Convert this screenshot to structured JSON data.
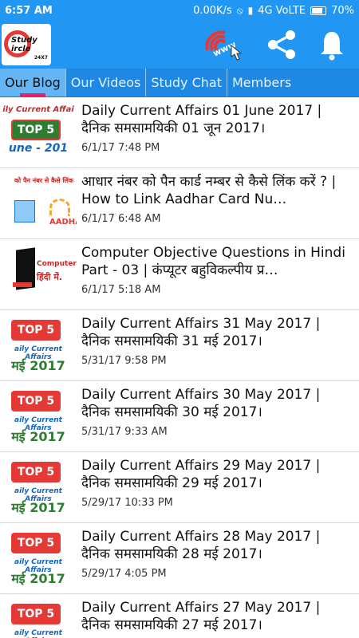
{
  "status": {
    "time": "6:57 AM",
    "speed": "0.00K/s",
    "network": "4G VoLTE",
    "battery": "70%"
  },
  "appbar": {
    "logo_text": "Study ircle",
    "logo_sub": "24X7",
    "icons": [
      "www-icon",
      "share-icon",
      "bell-icon"
    ]
  },
  "tabs": [
    {
      "label": "Our Blog",
      "active": true
    },
    {
      "label": "Our Videos",
      "active": false
    },
    {
      "label": "Study Chat",
      "active": false
    },
    {
      "label": "Members",
      "active": false
    }
  ],
  "colors": {
    "primary": "#2196f3",
    "tab_indicator": "#e91e63",
    "badge_red": "#e53935",
    "green": "#2e7d32"
  },
  "items": [
    {
      "title": "Daily Current Affairs 01 June 2017 | दैनिक समसामयिकी 01 जून 2017।",
      "date": "6/1/17 7:48 PM",
      "thumb": {
        "type": "top5-green",
        "badge": "TOP 5",
        "line1": "ily Current Affai",
        "line2": "une - 201"
      }
    },
    {
      "title": "आधार नंबर को पैन कार्ड नम्बर से कैसे लिंक करें ? | How to Link Aadhar Card Nu…",
      "date": "6/1/17 6:48 AM",
      "thumb": {
        "type": "aadhar",
        "top": "को पैन नंबर से कैसे लिंक",
        "label": "AADHA"
      }
    },
    {
      "title": "Computer Objective Questions in Hindi Part - 03 | कंप्यूटर बहुविकल्पीय प्र…",
      "date": "6/1/17 5:18 AM",
      "thumb": {
        "type": "computer",
        "line1": "Computer M",
        "line2": "हिंदी में."
      }
    },
    {
      "title": "Daily Current Affairs 31 May 2017 | दैनिक समसामयिकी 31 मई 2017।",
      "date": "5/31/17 9:58 PM",
      "thumb": {
        "type": "top5",
        "badge": "TOP 5",
        "line1": "aily Current Affairs",
        "line2": "मई 2017"
      }
    },
    {
      "title": "Daily Current Affairs 30 May 2017 | दैनिक समसामयिकी 30 मई 2017।",
      "date": "5/31/17 9:33 AM",
      "thumb": {
        "type": "top5",
        "badge": "TOP 5",
        "line1": "aily Current Affairs",
        "line2": "मई 2017"
      }
    },
    {
      "title": "Daily Current Affairs 29 May 2017 | दैनिक समसामयिकी 29 मई 2017।",
      "date": "5/29/17 10:33 PM",
      "thumb": {
        "type": "top5",
        "badge": "TOP 5",
        "line1": "aily Current Affairs",
        "line2": "मई 2017"
      }
    },
    {
      "title": "Daily Current Affairs 28 May 2017 | दैनिक समसामयिकी 28 मई 2017।",
      "date": "5/29/17 4:05 PM",
      "thumb": {
        "type": "top5",
        "badge": "TOP 5",
        "line1": "aily Current Affairs",
        "line2": "मई 2017"
      }
    },
    {
      "title": "Daily Current Affairs 27 May 2017 | दैनिक समसामयिकी 27 मई 2017।",
      "date": "",
      "thumb": {
        "type": "top5",
        "badge": "TOP 5",
        "line1": "aily Current Affairs",
        "line2": ""
      }
    }
  ]
}
